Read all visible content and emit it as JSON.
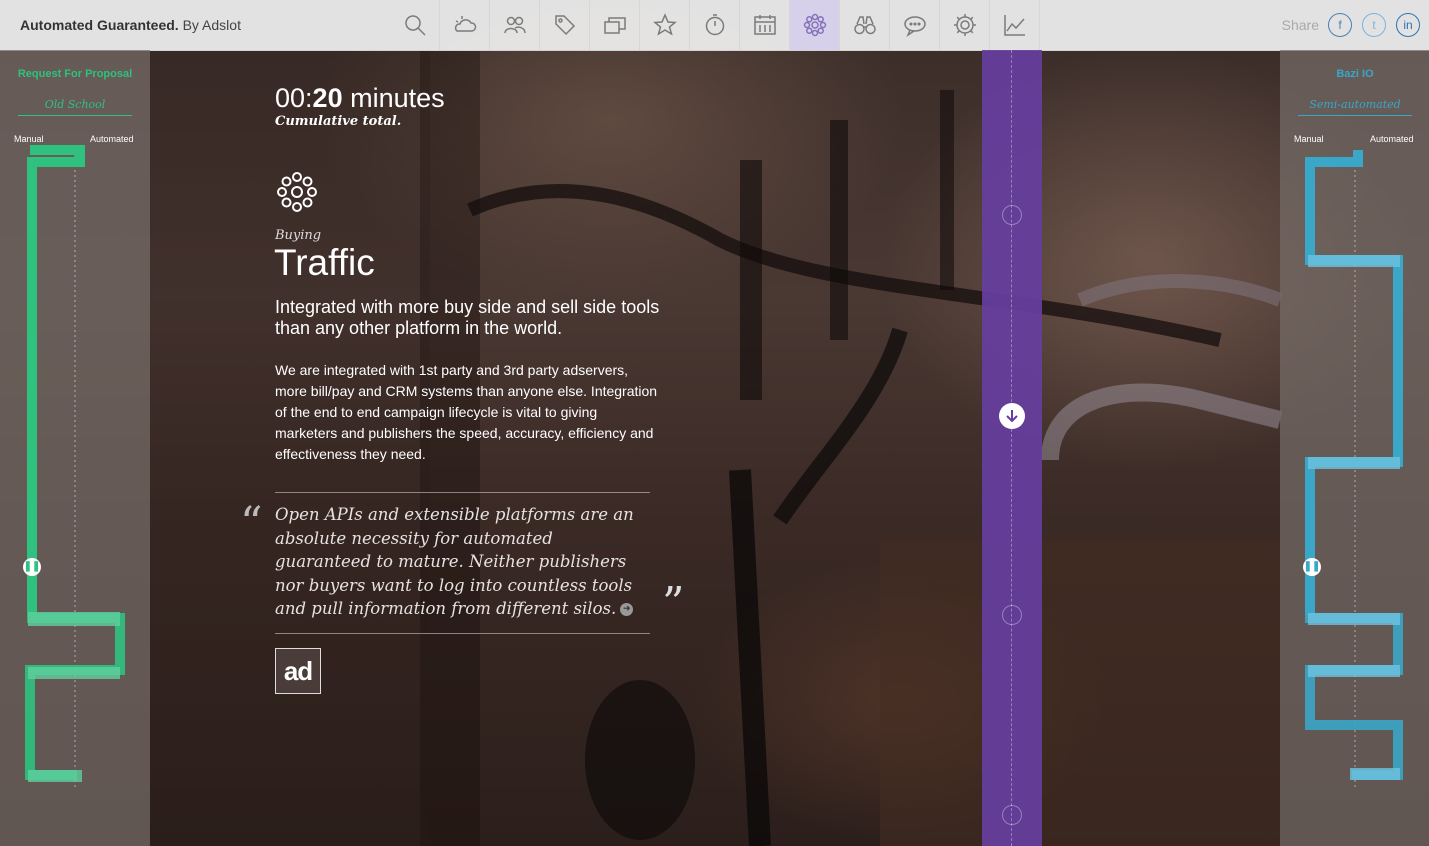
{
  "header": {
    "brand_bold": "Automated Guaranteed.",
    "brand_rest": " By Adslot",
    "share_label": "Share",
    "social": {
      "facebook": "f",
      "twitter": "t",
      "linkedin": "in"
    },
    "nav_icons": [
      "search-icon",
      "weather-icon",
      "people-icon",
      "tag-icon",
      "screens-icon",
      "star-icon",
      "timer-icon",
      "calendar-icon",
      "flower-icon",
      "binoculars-icon",
      "chat-icon",
      "gear-icon",
      "chart-icon"
    ],
    "active_icon": "flower-icon"
  },
  "left_panel": {
    "title": "Request For Proposal",
    "subtitle": "Old School",
    "scale_left": "Manual",
    "scale_right": "Automated",
    "accent": "#2ec27e"
  },
  "right_panel": {
    "title": "Bazi IO",
    "subtitle": "Semi-automated",
    "scale_left": "Manual",
    "scale_right": "Automated",
    "accent": "#3aa6c8"
  },
  "main": {
    "timer_prefix": "00:",
    "timer_bold": "20",
    "timer_suffix": " minutes",
    "cumulative": "Cumulative total.",
    "kicker": "Buying",
    "title": "Traffic",
    "lead": "Integrated with more buy side and sell side tools than any other platform in the world.",
    "body": "We are integrated with 1st party and 3rd party adservers, more bill/pay and CRM systems than anyone else. Integration of the end to end campaign lifecycle is vital to giving marketers and publishers the speed, accuracy, efficiency and effectiveness they need.",
    "quote": "Open APIs and extensible platforms are an absolute necessity for automated guaranteed to mature. Neither publishers nor buyers want to log into countless tools and pull information from different silos.",
    "quote_open": "“",
    "quote_close": "”",
    "logo_text": "ad"
  },
  "colors": {
    "purple_column": "#663ea0",
    "green_track": "#2ec27e",
    "blue_track": "#3aa6c8"
  }
}
